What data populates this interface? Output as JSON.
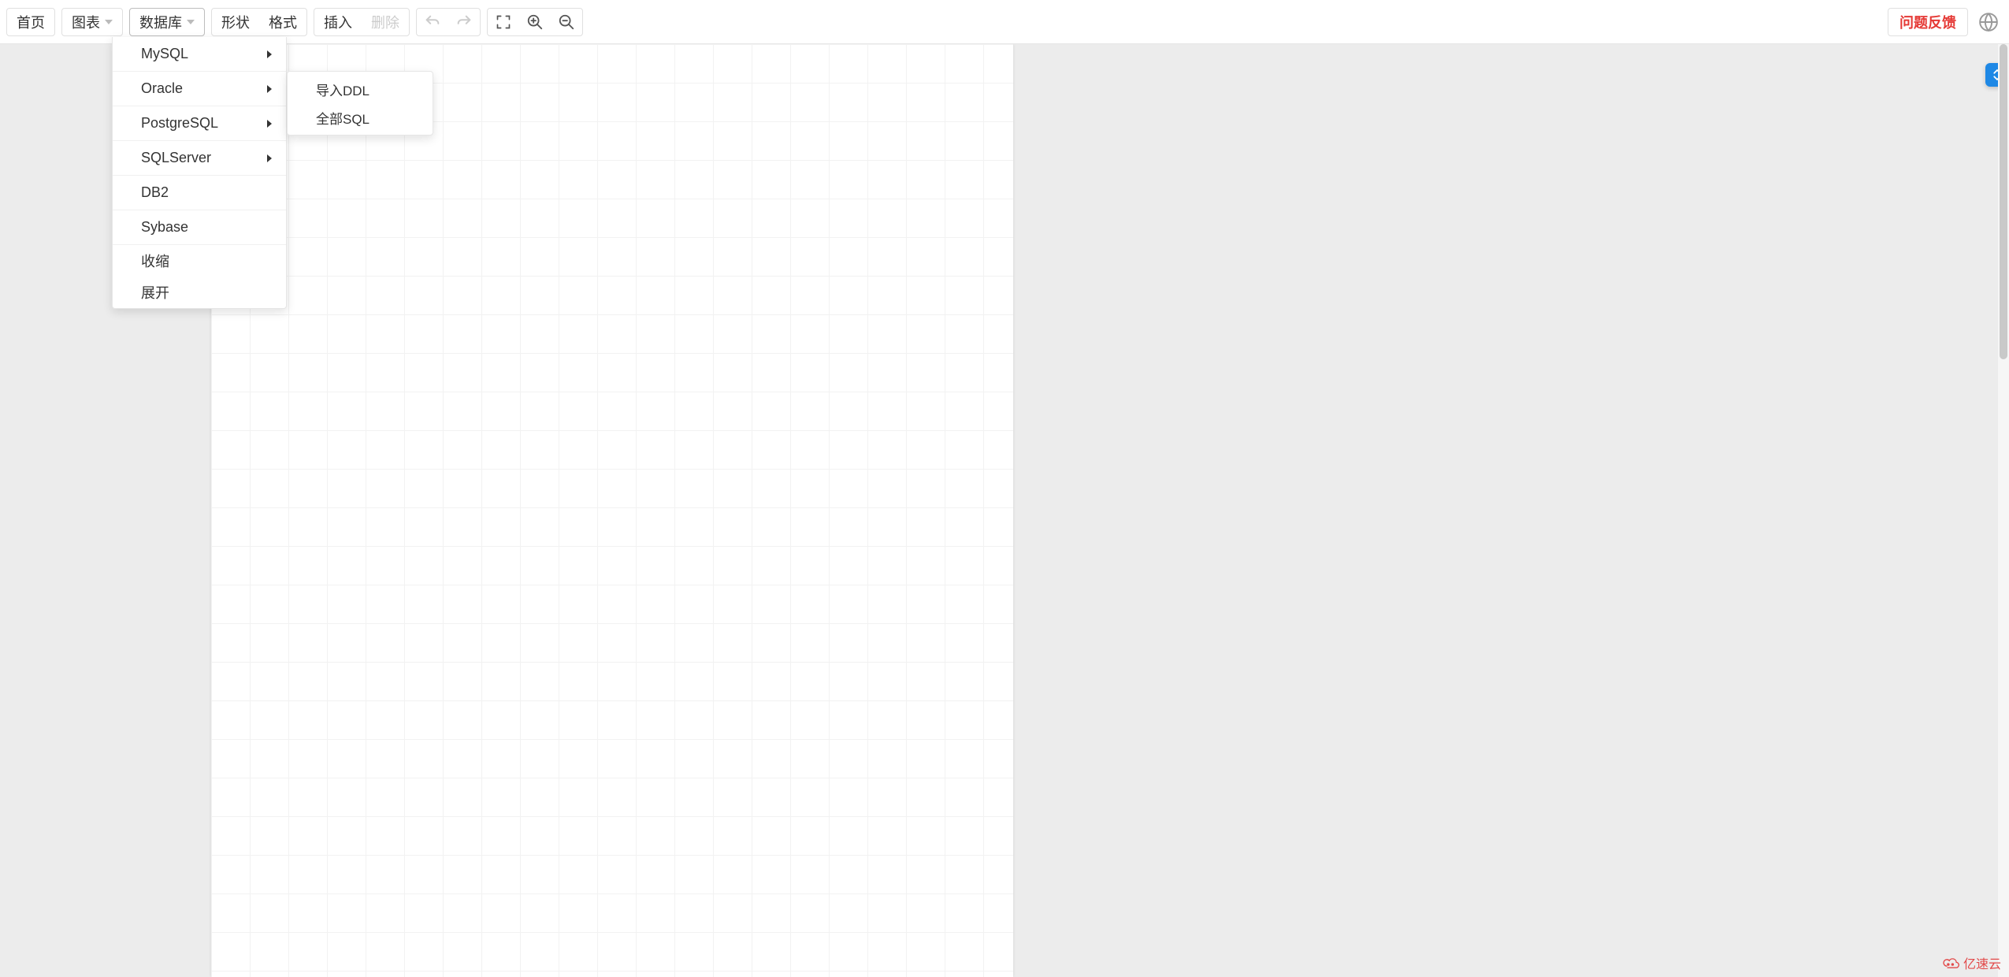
{
  "toolbar": {
    "home": "首页",
    "chart": "图表",
    "database": "数据库",
    "shape": "形状",
    "format": "格式",
    "insert": "插入",
    "delete": "删除",
    "feedback": "问题反馈"
  },
  "dropdown": {
    "mysql": "MySQL",
    "oracle": "Oracle",
    "postgresql": "PostgreSQL",
    "sqlserver": "SQLServer",
    "db2": "DB2",
    "sybase": "Sybase",
    "collapse": "收缩",
    "expand": "展开"
  },
  "submenu": {
    "import_ddl": "导入DDL",
    "all_sql": "全部SQL"
  },
  "footer": {
    "brand": "亿速云"
  },
  "icons": {
    "undo": "undo-icon",
    "redo": "redo-icon",
    "fullscreen": "fullscreen-icon",
    "zoom_in": "zoom-in-icon",
    "zoom_out": "zoom-out-icon",
    "globe": "globe-icon",
    "chevron_down": "chevron-down-icon",
    "arrow_right": "arrow-right-icon"
  }
}
